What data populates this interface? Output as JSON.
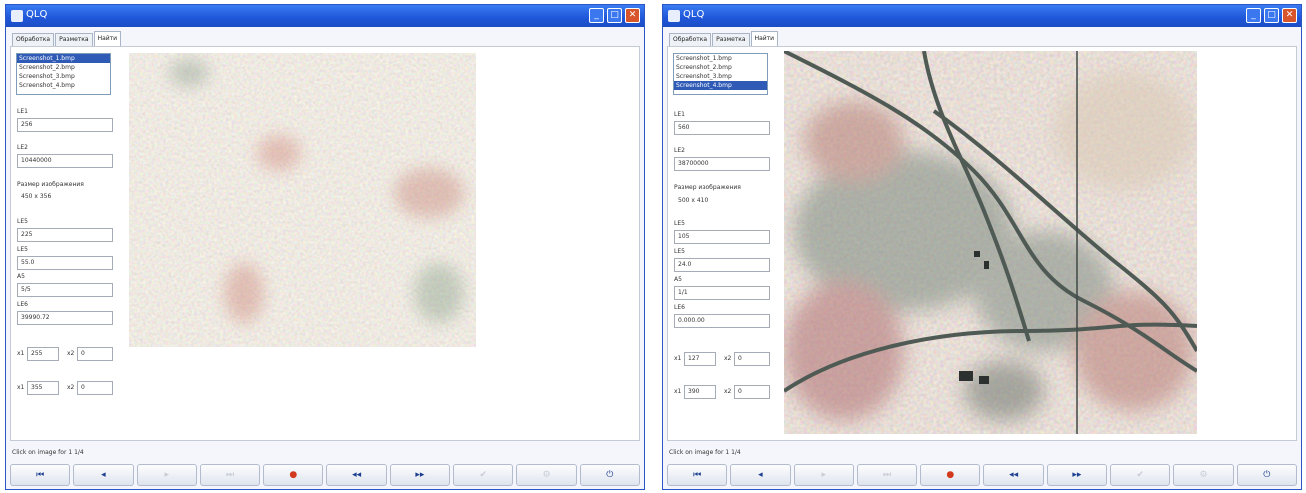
{
  "windows": [
    {
      "title": "QLQ",
      "tabs": [
        "Обработка",
        "Разметка",
        "Найти"
      ],
      "active_tab": 2,
      "files": [
        "Screenshot_1.bmp",
        "Screenshot_2.bmp",
        "Screenshot_3.bmp",
        "Screenshot_4.bmp"
      ],
      "selected_file": 0,
      "l1_label": "LE1",
      "l1_value": "256",
      "l2_label": "LE2",
      "l2_value": "10440000",
      "size_label": "Размер изображения",
      "size_value": "450 x 356",
      "l3_label": "LE5",
      "l3_value": "225",
      "l4_label": "LE5",
      "l4_value": "55.0",
      "l5_label": "A5",
      "l5_value": "5/5",
      "l6_label": "LE6",
      "l6_value": "39990.72",
      "x1_label": "x1",
      "x1_value": "255",
      "y1_label": "x2",
      "y1_value": "0",
      "x2_label": "x1",
      "x2_value": "355",
      "y2_label": "x2",
      "y2_value": "0",
      "status": "Click on image for 1 1/4",
      "buttons": [
        "⏮",
        "◂",
        "▸",
        "⏭",
        "●",
        "◂◂",
        "▸▸",
        "✔",
        "⚙",
        "⏻"
      ]
    },
    {
      "title": "QLQ",
      "tabs": [
        "Обработка",
        "Разметка",
        "Найти"
      ],
      "active_tab": 2,
      "files": [
        "Screenshot_1.bmp",
        "Screenshot_2.bmp",
        "Screenshot_3.bmp",
        "Screenshot_4.bmp"
      ],
      "selected_file": 3,
      "l1_label": "LE1",
      "l1_value": "560",
      "l2_label": "LE2",
      "l2_value": "38700000",
      "size_label": "Размер изображения",
      "size_value": "500 x 410",
      "l3_label": "LE5",
      "l3_value": "105",
      "l4_label": "LE5",
      "l4_value": "24.0",
      "l5_label": "A5",
      "l5_value": "1/1",
      "l6_label": "LE6",
      "l6_value": "0.000.00",
      "x1_label": "x1",
      "x1_value": "127",
      "y1_label": "x2",
      "y1_value": "0",
      "x2_label": "x1",
      "x2_value": "390",
      "y2_label": "x2",
      "y2_value": "0",
      "status": "Click on image for 1 1/4",
      "buttons": [
        "⏮",
        "◂",
        "▸",
        "⏭",
        "●",
        "◂◂",
        "▸▸",
        "✔",
        "⚙",
        "⏻"
      ]
    }
  ],
  "colors": {
    "titlebar": "#1f56d8",
    "selection": "#2f5bb7",
    "texture_base": "#ddd3c4",
    "road": "#4f5a55"
  }
}
